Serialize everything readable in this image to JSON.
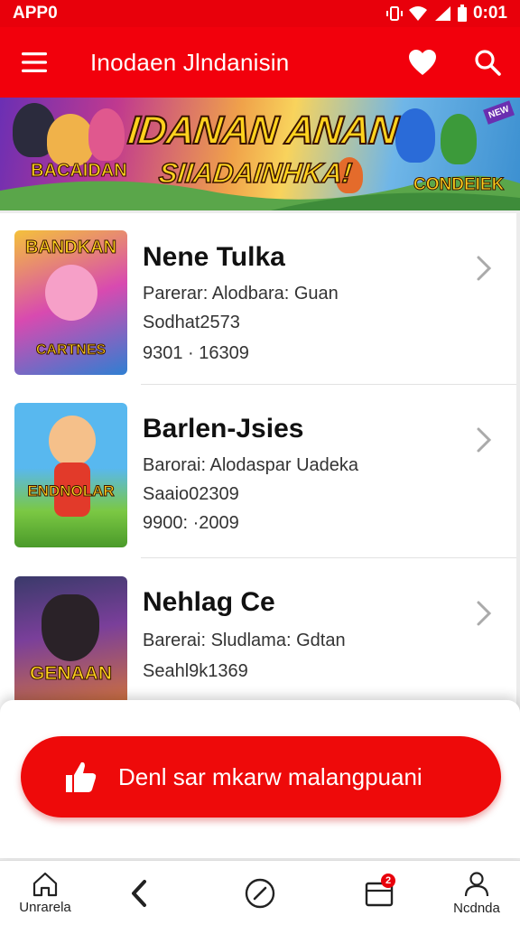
{
  "status_bar": {
    "carrier": "APP0",
    "time": "0:01"
  },
  "app_bar": {
    "title": "Inodaen Jlndanisin",
    "icons": [
      "menu-icon",
      "heart-icon",
      "search-icon"
    ]
  },
  "banner": {
    "title": "IDANAN ANAN",
    "subtitle": "SIIADAINHKA!",
    "left_tag": "BACAIDAN",
    "right_tag": "CONDEIEK",
    "corner_tag": "NEW"
  },
  "items": [
    {
      "title": "Nene Tulka",
      "line1": "Parerar: Alodbara: Guan",
      "line2": "Sodhat2573",
      "line3": "9301 · 16309",
      "thumb_label_top": "BANDKAN",
      "thumb_label_bottom": "CARTNES",
      "thumb_colors": [
        "#f4c13b",
        "#d84ab0",
        "#2f7fd2"
      ]
    },
    {
      "title": "Barlen-Jsies",
      "line1": "Barorai: Alodaspar Uadeka",
      "line2": "Saaio02309",
      "line3": "9900: ·2009",
      "thumb_label_top": "",
      "thumb_label_bottom": "ENDNOLAR",
      "thumb_colors": [
        "#58b8ef",
        "#7bc843",
        "#f06a2e"
      ]
    },
    {
      "title": "Nehlag Ce",
      "line1": "Barerai: Sludlama: Gdtan",
      "line2": "Seahl9k1369",
      "line3": "",
      "thumb_label_top": "",
      "thumb_label_bottom": "GENAAN",
      "thumb_colors": [
        "#3a3a6a",
        "#e07b2a",
        "#7a3f9a"
      ]
    }
  ],
  "cta": {
    "label": "Denl sar mkarw malangpuani",
    "icon": "thumbs-up-icon"
  },
  "bottom_nav": [
    {
      "label": "Unrarela",
      "icon": "home-icon"
    },
    {
      "label": "",
      "icon": "back-icon"
    },
    {
      "label": "",
      "icon": "compass-icon"
    },
    {
      "label": "",
      "icon": "inbox-icon",
      "badge": "2"
    },
    {
      "label": "Ncdnda",
      "icon": "profile-icon"
    }
  ],
  "colors": {
    "brand_red": "#f2000c",
    "cta_red": "#ee0a0a"
  }
}
